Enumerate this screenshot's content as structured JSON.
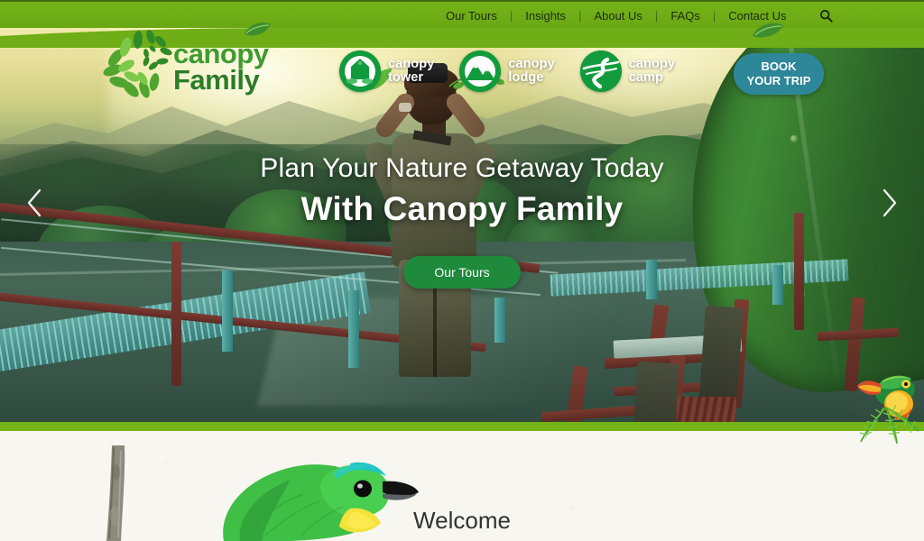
{
  "site": {
    "name": "Canopy Family",
    "logo_line1": "canopy",
    "logo_line2": "Family",
    "logo_icon": "leaf-spiral-icon"
  },
  "nav": {
    "items": [
      {
        "label": "Our Tours"
      },
      {
        "label": "Insights"
      },
      {
        "label": "About Us"
      },
      {
        "label": "FAQs"
      },
      {
        "label": "Contact Us"
      }
    ],
    "separator": "|",
    "search_icon": "search-icon",
    "bar_color": "#6fae16"
  },
  "brands": [
    {
      "name": "canopy tower",
      "line1": "canopy",
      "line2": "tower",
      "icon": "tower-building-icon",
      "color": "#119b3c"
    },
    {
      "name": "canopy lodge",
      "line1": "canopy",
      "line2": "lodge",
      "icon": "mountain-icon",
      "color": "#119b3c"
    },
    {
      "name": "canopy camp",
      "line1": "canopy",
      "line2": "camp",
      "icon": "winding-river-path-icon",
      "color": "#119b3c"
    }
  ],
  "book_button": {
    "line1": "BOOK",
    "line2": "YOUR TRIP",
    "color": "#2e8799"
  },
  "hero": {
    "headline_line1": "Plan Your Nature Getaway Today",
    "headline_line2": "With Canopy Family",
    "cta_label": "Our Tours",
    "cta_color": "#1f8a3c",
    "prev_icon": "chevron-left-icon",
    "next_icon": "chevron-right-icon",
    "scene_description": "Birdwatcher with binoculars on rainforest observation deck"
  },
  "divider": {
    "color": "#74b417"
  },
  "welcome": {
    "title": "Welcome",
    "background": "#f7f6f1",
    "bird_icon": "green-honeycreeper-bird",
    "branch_icon": "tree-branch",
    "toucan_icon": "keel-billed-toucan"
  }
}
